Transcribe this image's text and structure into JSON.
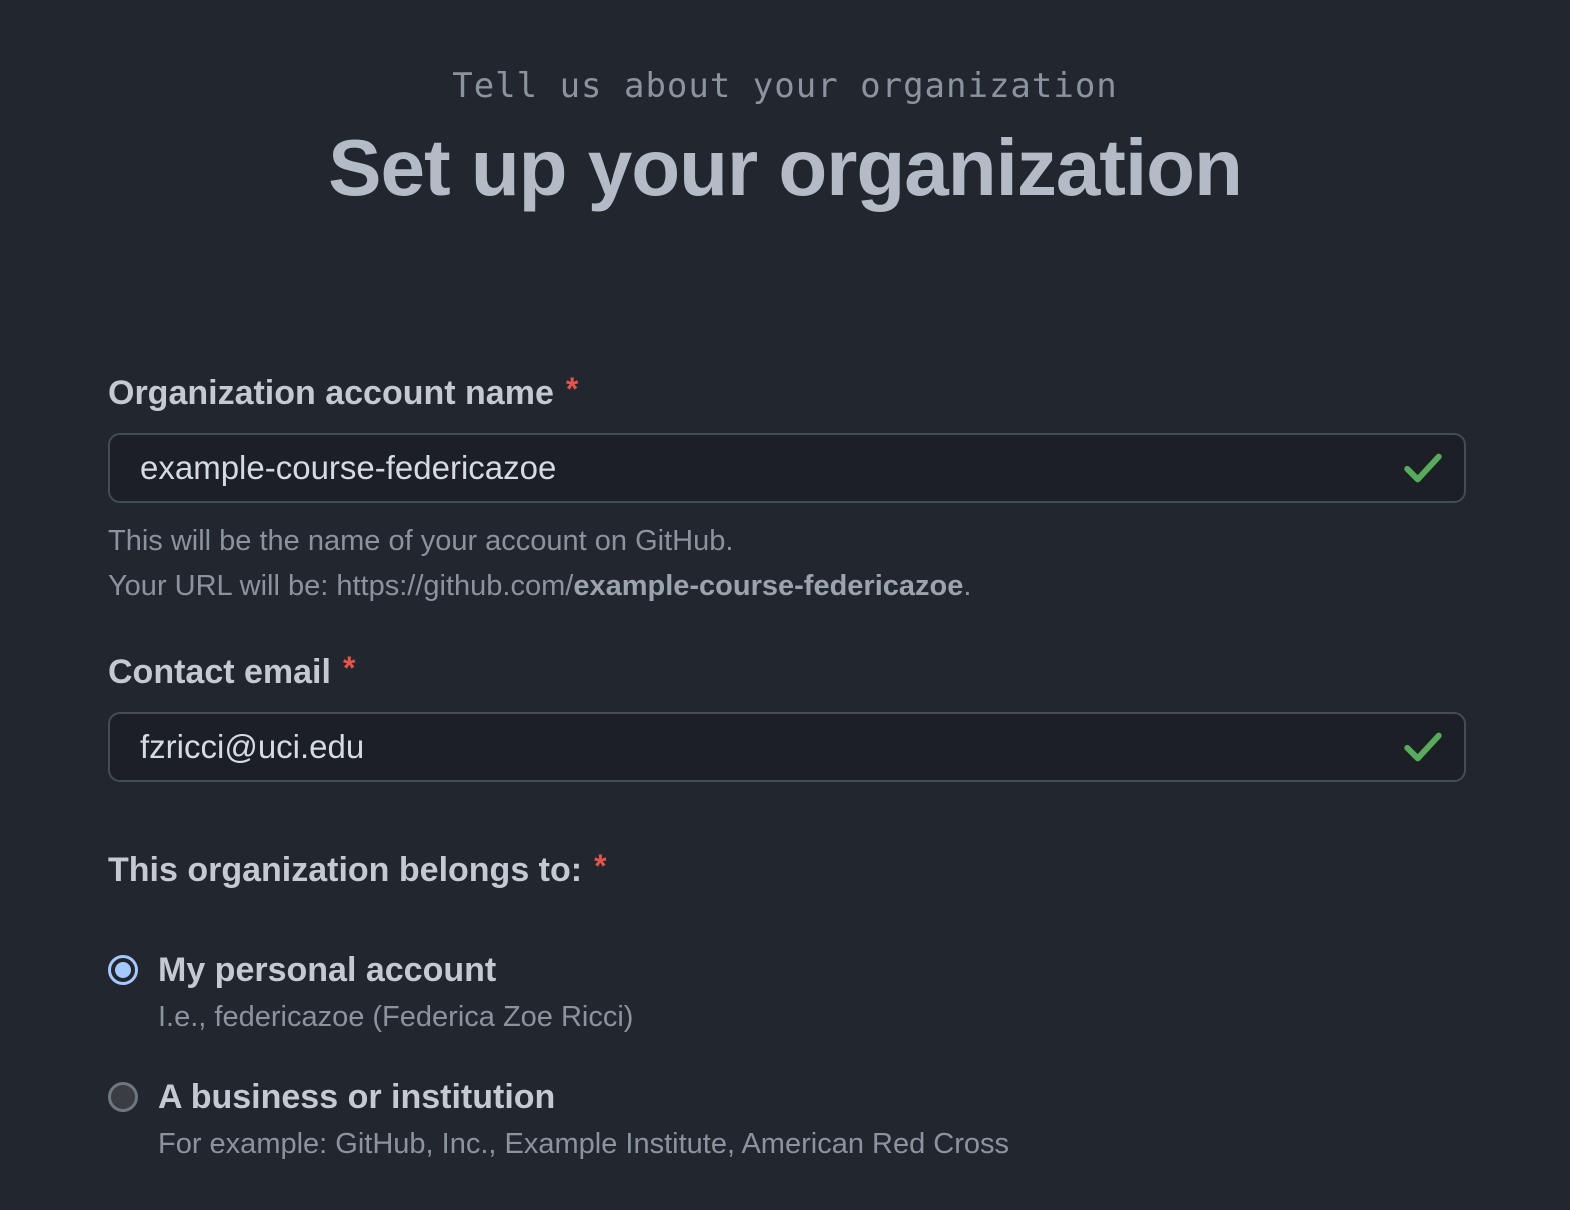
{
  "header": {
    "eyebrow": "Tell us about your organization",
    "title": "Set up your organization"
  },
  "org_name": {
    "label": "Organization account name",
    "required_mark": "*",
    "value": "example-course-federicazoe",
    "icon": "check-icon",
    "hint_line1": "This will be the name of your account on GitHub.",
    "hint_line2_prefix": "Your URL will be: https://github.com/",
    "hint_line2_bold": "example-course-federicazoe",
    "hint_line2_suffix": "."
  },
  "contact_email": {
    "label": "Contact email",
    "required_mark": "*",
    "value": "fzricci@uci.edu",
    "icon": "check-icon"
  },
  "belongs_to": {
    "label": "This organization belongs to:",
    "required_mark": "*",
    "options": [
      {
        "label": "My personal account",
        "description": "I.e., federicazoe (Federica Zoe Ricci)",
        "selected": true
      },
      {
        "label": "A business or institution",
        "description": "For example: GitHub, Inc., Example Institute, American Red Cross",
        "selected": false
      }
    ]
  },
  "colors": {
    "background": "#22262f",
    "required": "#e5534b",
    "check": "#57ab5a",
    "radio_selected": "#a5c8ff"
  }
}
